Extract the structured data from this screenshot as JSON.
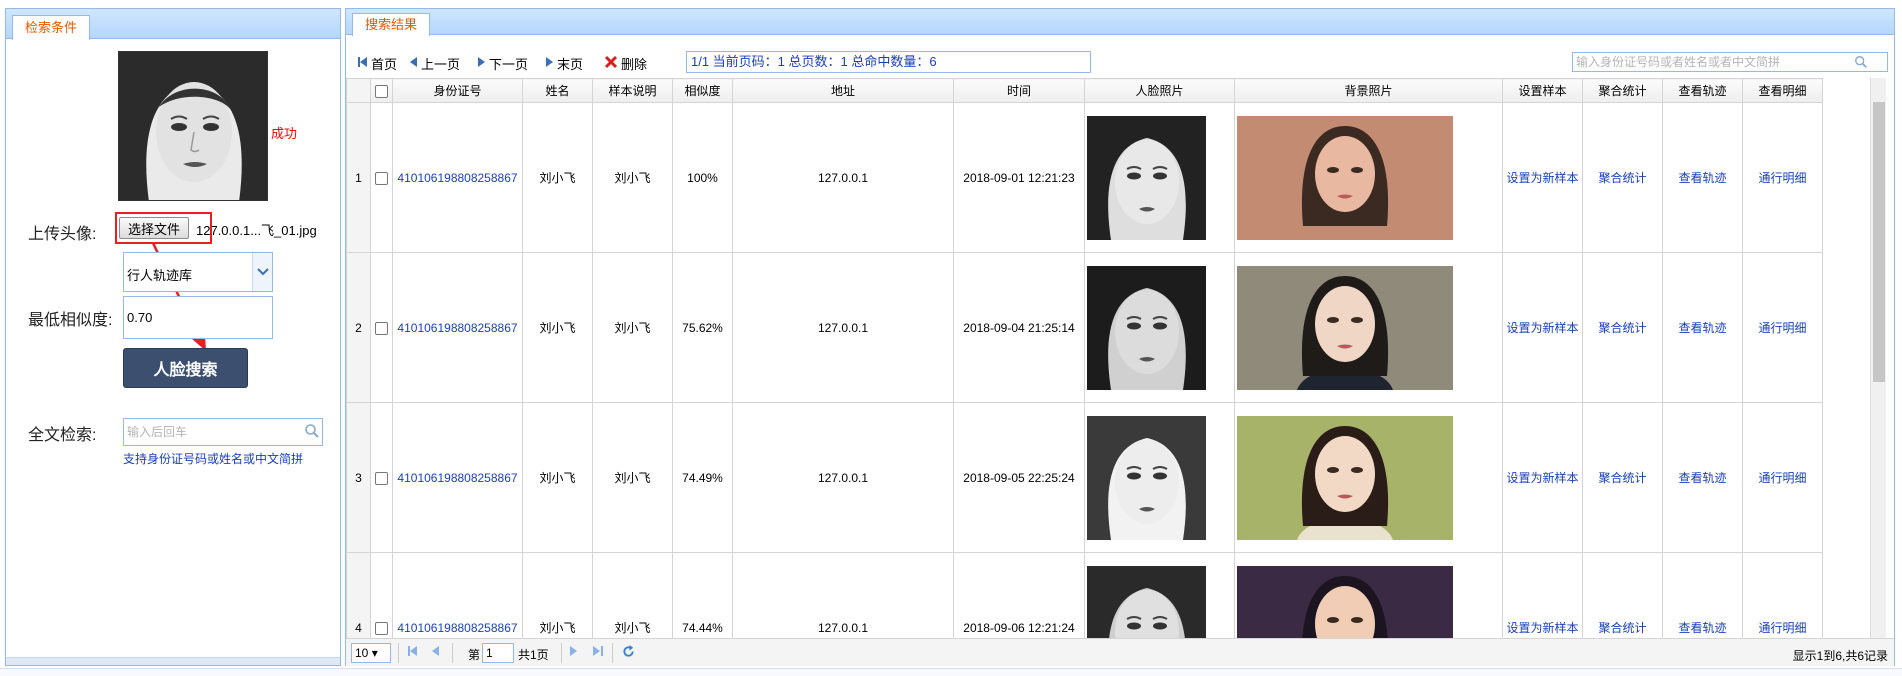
{
  "left_panel": {
    "tab_title": "检索条件",
    "upload_status": "成功",
    "upload_label": "上传头像:",
    "file_button_label": "选择文件",
    "file_name": "127.0.0.1...飞_01.jpg",
    "library_select_value": "行人轨迹库",
    "similarity_label": "最低相似度:",
    "similarity_value": "0.70",
    "face_search_button": "人脸搜索",
    "fulltext_label": "全文检索:",
    "fulltext_placeholder": "输入后回车",
    "fulltext_hint": "支持身份证号码或姓名或中文简拼"
  },
  "right_panel": {
    "tab_title": "搜索结果",
    "toolbar": {
      "first": "首页",
      "prev": "上一页",
      "next": "下一页",
      "last": "末页",
      "delete": "删除",
      "page_info": "1/1 当前页码：1 总页数：1 总命中数量：6",
      "search_placeholder": "输入身份证号码或者姓名或者中文简拼"
    },
    "columns": [
      "身份证号",
      "姓名",
      "样本说明",
      "相似度",
      "地址",
      "时间",
      "人脸照片",
      "背景照片",
      "设置样本",
      "聚合统计",
      "查看轨迹",
      "查看明细"
    ],
    "rows": [
      {
        "num": "1",
        "id": "410106198808258867",
        "name": "刘小飞",
        "note": "刘小飞",
        "similarity": "100%",
        "address": "127.0.0.1",
        "time": "2018-09-01 12:21:23",
        "set_sample": "设置为新样本",
        "stats": "聚合统计",
        "track": "查看轨迹",
        "detail": "通行明细"
      },
      {
        "num": "2",
        "id": "410106198808258867",
        "name": "刘小飞",
        "note": "刘小飞",
        "similarity": "75.62%",
        "address": "127.0.0.1",
        "time": "2018-09-04 21:25:14",
        "set_sample": "设置为新样本",
        "stats": "聚合统计",
        "track": "查看轨迹",
        "detail": "通行明细"
      },
      {
        "num": "3",
        "id": "410106198808258867",
        "name": "刘小飞",
        "note": "刘小飞",
        "similarity": "74.49%",
        "address": "127.0.0.1",
        "time": "2018-09-05 22:25:24",
        "set_sample": "设置为新样本",
        "stats": "聚合统计",
        "track": "查看轨迹",
        "detail": "通行明细"
      },
      {
        "num": "4",
        "id": "410106198808258867",
        "name": "刘小飞",
        "note": "刘小飞",
        "similarity": "74.44%",
        "address": "127.0.0.1",
        "time": "2018-09-06 12:21:24",
        "set_sample": "设置为新样本",
        "stats": "聚合统计",
        "track": "查看轨迹",
        "detail": "通行明细"
      }
    ],
    "pager": {
      "page_size": "10",
      "page_pre": "第",
      "page_value": "1",
      "page_post": "共1页",
      "info": "显示1到6,共6记录"
    }
  },
  "colors": {
    "panel_border": "#95b8e7",
    "header_bg": "#cfe6ff",
    "tab_title": "#e05a00",
    "link": "#1a3fb5",
    "search_button": "#3c4f6e",
    "annotation": "#e81f1f"
  },
  "icons": {
    "first": "first-page-icon",
    "prev": "prev-page-icon",
    "next": "next-page-icon",
    "last": "last-page-icon",
    "delete": "delete-x-icon",
    "search": "magnifier-icon",
    "refresh": "refresh-icon"
  }
}
